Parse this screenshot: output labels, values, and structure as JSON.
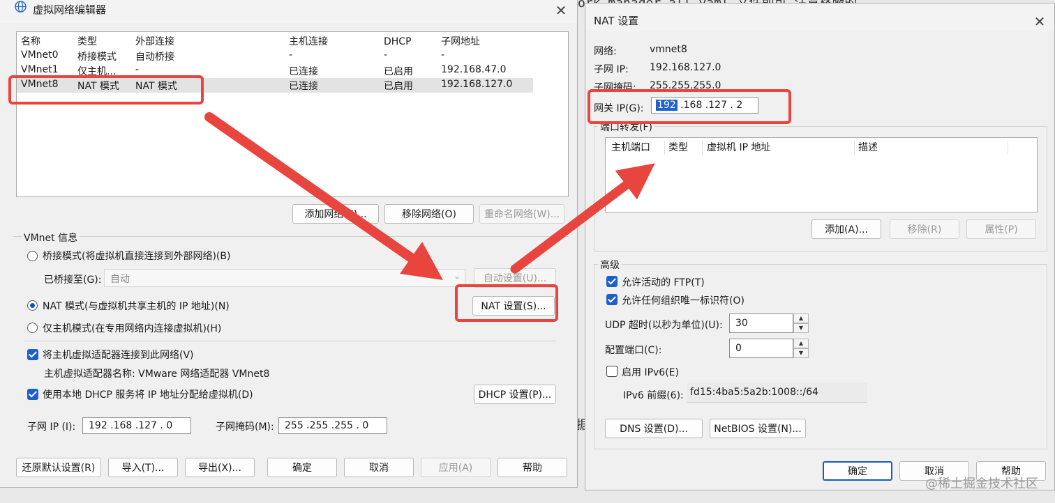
{
  "bg_text": {
    "top_right": "ork-manager-all.yaml 文件即可,注意格腋的",
    "middle_char": "据",
    "watermark": "@稀土掘金技术社区"
  },
  "left": {
    "title": "虚拟网络编辑器",
    "columns": [
      "名称",
      "类型",
      "外部连接",
      "主机连接",
      "DHCP",
      "子网地址"
    ],
    "rows": [
      [
        "VMnet0",
        "桥接模式",
        "自动桥接",
        "-",
        "-",
        "-"
      ],
      [
        "VMnet1",
        "仅主机...",
        "-",
        "已连接",
        "已启用",
        "192.168.47.0"
      ],
      [
        "VMnet8",
        "NAT 模式",
        "NAT 模式",
        "已连接",
        "已启用",
        "192.168.127.0"
      ]
    ],
    "add_network": "添加网络(E)...",
    "remove_network": "移除网络(O)",
    "rename_network": "重命名网络(W)...",
    "info_title": "VMnet 信息",
    "bridged_mode": "桥接模式(将虚拟机直接连接到外部网络)(B)",
    "bridged_to_label": "已桥接至(G):",
    "bridged_to_value": "自动",
    "auto_settings": "自动设置(U)...",
    "nat_mode": "NAT 模式(与虚拟机共享主机的 IP 地址)(N)",
    "nat_settings": "NAT 设置(S)...",
    "host_only_mode": "仅主机模式(在专用网络内连接虚拟机)(H)",
    "connect_adapter": "将主机虚拟适配器连接到此网络(V)",
    "adapter_name": "主机虚拟适配器名称: VMware 网络适配器 VMnet8",
    "use_dhcp": "使用本地 DHCP 服务将 IP 地址分配给虚拟机(D)",
    "dhcp_settings": "DHCP 设置(P)...",
    "subnet_ip_label": "子网 IP (I):",
    "subnet_ip": "192 .168 .127 .  0",
    "subnet_mask_label": "子网掩码(M):",
    "subnet_mask": "255 .255 .255 .  0",
    "buttons": [
      "还原默认设置(R)",
      "导入(T)...",
      "导出(X)...",
      "确定",
      "取消",
      "应用(A)",
      "帮助"
    ]
  },
  "right": {
    "title": "NAT 设置",
    "network_label": "网络:",
    "network_value": "vmnet8",
    "subnet_ip_label": "子网 IP:",
    "subnet_ip_value": "192.168.127.0",
    "subnet_mask_label": "子网掩码:",
    "subnet_mask_value": "255.255.255.0",
    "gateway_label": "网关 IP(G):",
    "gateway_first": "192",
    "gateway_rest": " .168 .127 .  2",
    "port_forward_title": "端口转发(F)",
    "pf_columns": [
      "主机端口",
      "类型",
      "虚拟机 IP 地址",
      "描述"
    ],
    "pf_add": "添加(A)...",
    "pf_remove": "移除(R)",
    "pf_properties": "属性(P)",
    "advanced_title": "高级",
    "allow_ftp": "允许活动的 FTP(T)",
    "allow_oui": "允许任何组织唯一标识符(O)",
    "udp_timeout_label": "UDP 超时(以秒为单位)(U):",
    "udp_timeout_value": "30",
    "config_port_label": "配置端口(C):",
    "config_port_value": "0",
    "enable_ipv6": "启用 IPv6(E)",
    "ipv6_prefix_label": "IPv6 前缀(6):",
    "ipv6_prefix_value": "fd15:4ba5:5a2b:1008::/64",
    "dns_settings": "DNS 设置(D)...",
    "netbios_settings": "NetBIOS 设置(N)...",
    "ok": "确定",
    "cancel": "取消",
    "help": "帮助"
  },
  "colors": {
    "annotation_red": "#e8453f",
    "accent_blue": "#1f5fc9"
  }
}
